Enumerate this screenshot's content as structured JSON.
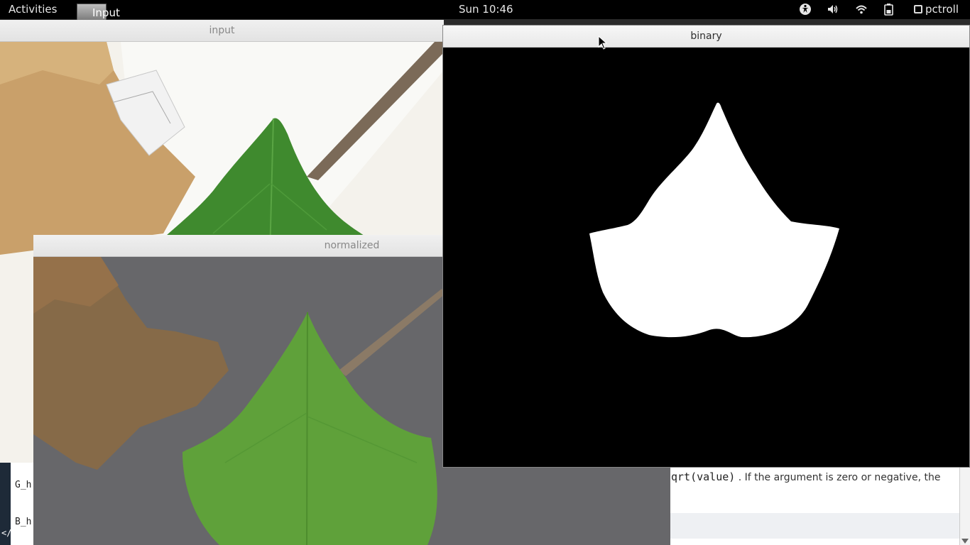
{
  "topbar": {
    "activities": "Activities",
    "app_menu_label": "Input",
    "clock": "Sun 10:46",
    "user": "pctroll",
    "tray_icons": [
      "accessibility-icon",
      "volume-icon",
      "wifi-icon",
      "battery-icon"
    ]
  },
  "windows": {
    "input": {
      "title": "input"
    },
    "normalized": {
      "title": "normalized"
    },
    "binary": {
      "title": "binary"
    }
  },
  "background_doc": {
    "code_line_1": "G_h",
    "code_line_2": "B_h",
    "left_glyph": "</",
    "text_code": "qrt(value)",
    "text_rest": ". If the argument is zero or negative, the"
  },
  "colors": {
    "topbar_bg": "#000000",
    "titlebar_bg": "#e8e8e8",
    "leaf_green": "#3f8a2e",
    "normalized_bg": "#67676a",
    "normalized_leaf": "#5fa13a",
    "binary_fg": "#ffffff",
    "binary_bg": "#000000"
  }
}
